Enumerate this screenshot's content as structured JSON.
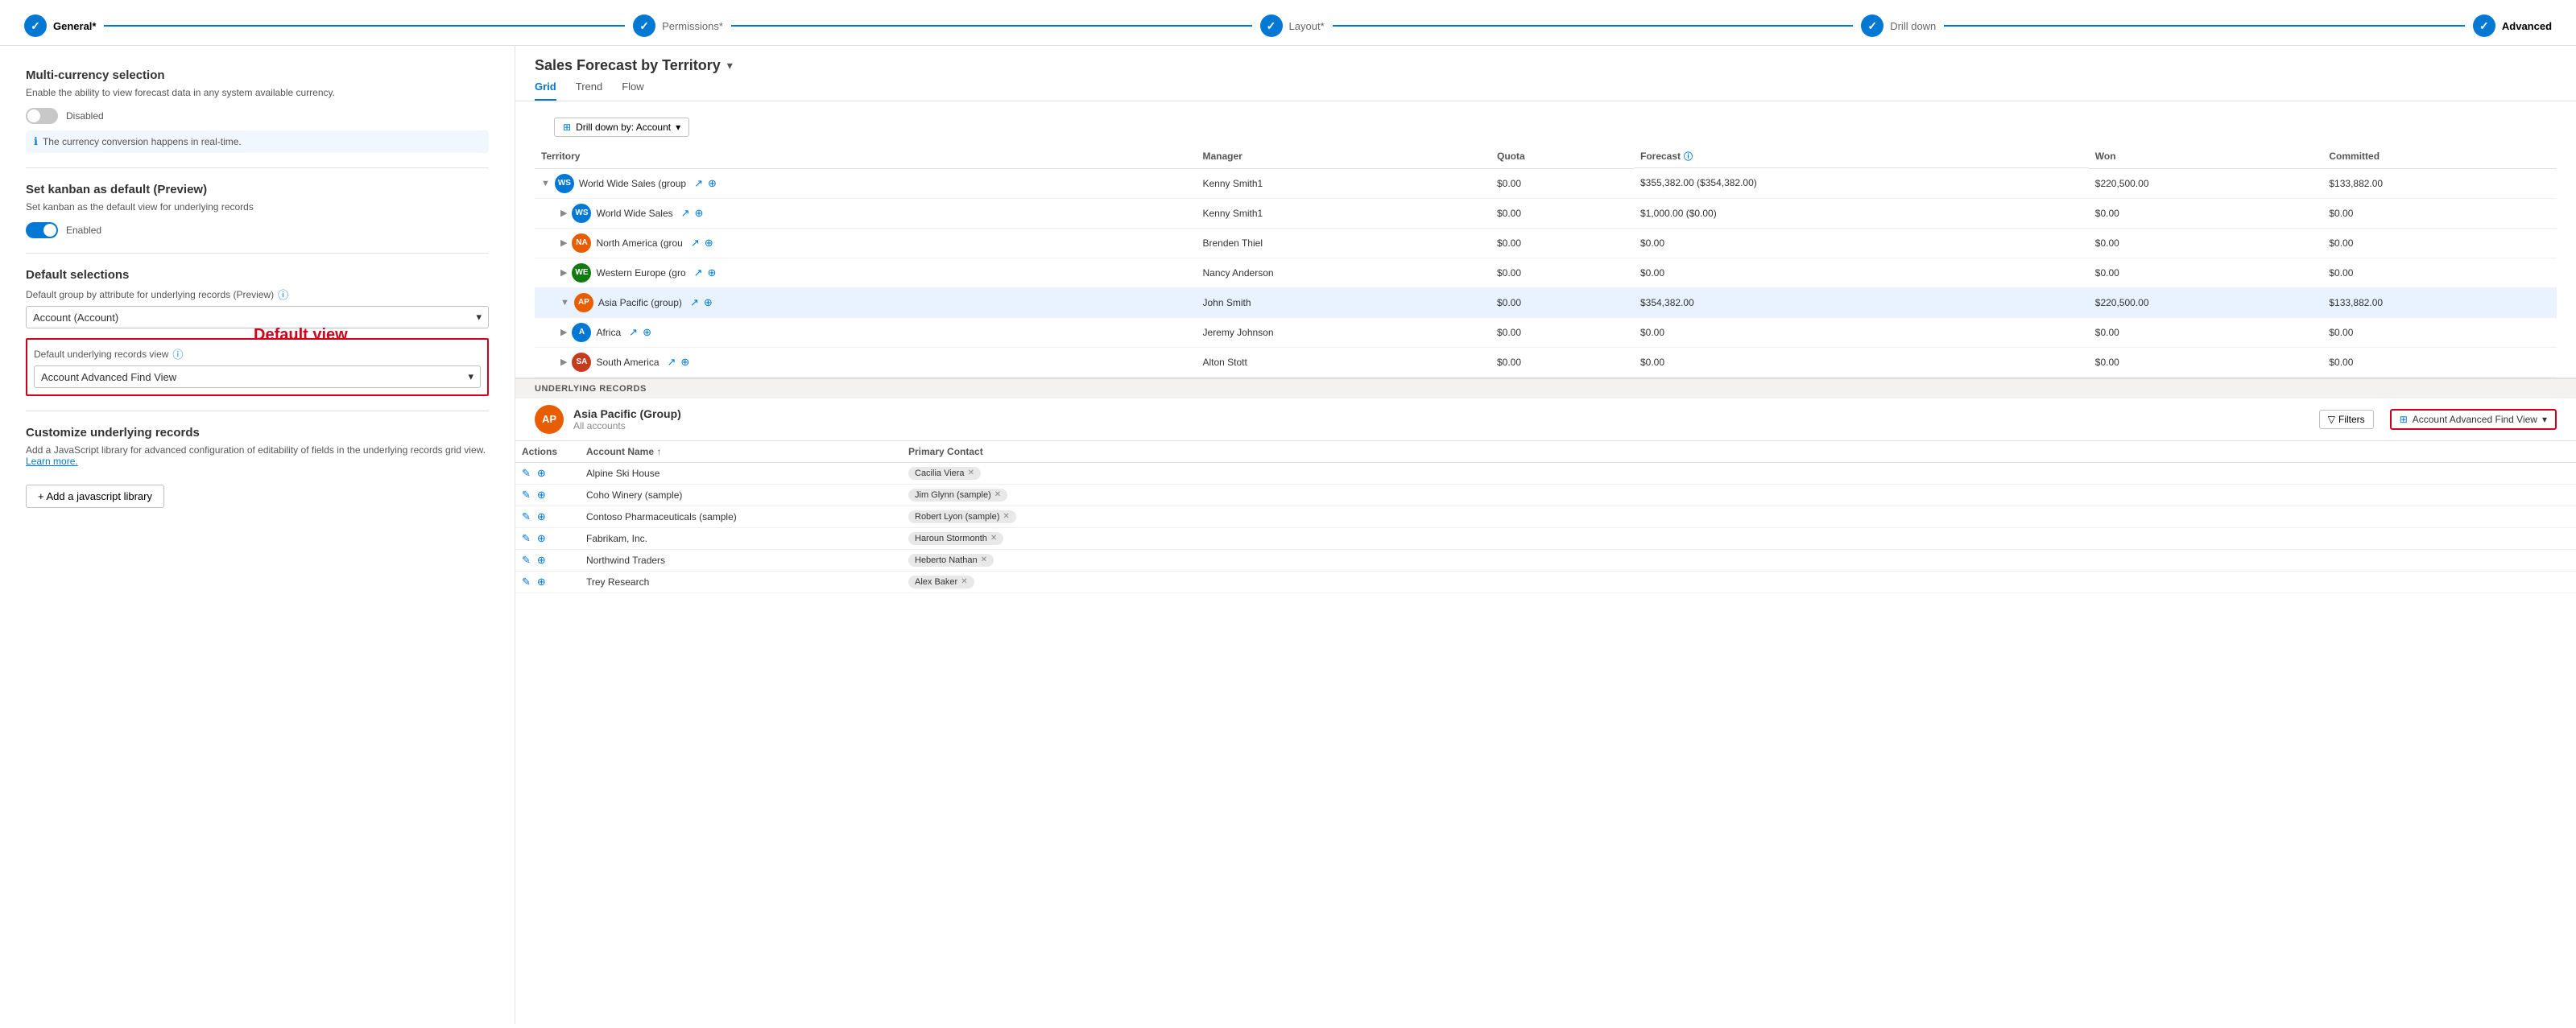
{
  "wizard": {
    "steps": [
      {
        "id": "general",
        "label": "General*",
        "active": false
      },
      {
        "id": "permissions",
        "label": "Permissions*",
        "active": false
      },
      {
        "id": "layout",
        "label": "Layout*",
        "active": false
      },
      {
        "id": "drilldown",
        "label": "Drill down",
        "active": false
      },
      {
        "id": "advanced",
        "label": "Advanced",
        "active": true
      }
    ]
  },
  "left": {
    "multicurrency": {
      "title": "Multi-currency selection",
      "desc": "Enable the ability to view forecast data in any system available currency.",
      "toggle_state": "off",
      "toggle_label": "Disabled",
      "info_text": "The currency conversion happens in real-time."
    },
    "kanban": {
      "title": "Set kanban as default (Preview)",
      "desc": "Set kanban as the default view for underlying records",
      "toggle_state": "on",
      "toggle_label": "Enabled"
    },
    "defaults": {
      "title": "Default selections",
      "group_attr_label": "Default group by attribute for underlying records (Preview)",
      "group_attr_value": "Account (Account)",
      "view_label": "Default underlying records view",
      "view_value": "Account Advanced Find View",
      "annotation": "Default view"
    },
    "customize": {
      "title": "Customize underlying records",
      "desc": "Add a JavaScript library for advanced configuration of editability of fields in the underlying records grid view.",
      "link_text": "Learn more.",
      "btn_label": "+ Add a javascript library"
    }
  },
  "right": {
    "title": "Sales Forecast by Territory",
    "tabs": [
      "Grid",
      "Trend",
      "Flow"
    ],
    "active_tab": "Grid",
    "drill_btn": "Drill down by: Account",
    "table": {
      "columns": [
        "Territory",
        "Manager",
        "Quota",
        "Forecast",
        "Won",
        "Committed"
      ],
      "rows": [
        {
          "indent": 0,
          "expanded": true,
          "avatar_bg": "#0078d4",
          "avatar_text": "WS",
          "territory": "World Wide Sales (group",
          "manager": "Kenny Smith1",
          "quota": "$0.00",
          "forecast": "$355,382.00 ($354,382.00)",
          "won": "$220,500.00",
          "committed": "$133,882.00",
          "highlighted": false
        },
        {
          "indent": 1,
          "expanded": false,
          "avatar_bg": "#0078d4",
          "avatar_text": "WS",
          "territory": "World Wide Sales",
          "manager": "Kenny Smith1",
          "quota": "$0.00",
          "forecast": "$1,000.00 ($0.00)",
          "won": "$0.00",
          "committed": "$0.00",
          "highlighted": false
        },
        {
          "indent": 1,
          "expanded": false,
          "avatar_bg": "#e85d00",
          "avatar_text": "NA",
          "territory": "North America (grou",
          "manager": "Brenden Thiel",
          "quota": "$0.00",
          "forecast": "$0.00",
          "won": "$0.00",
          "committed": "$0.00",
          "highlighted": false
        },
        {
          "indent": 1,
          "expanded": false,
          "avatar_bg": "#107c10",
          "avatar_text": "WE",
          "territory": "Western Europe (gro",
          "manager": "Nancy Anderson",
          "quota": "$0.00",
          "forecast": "$0.00",
          "won": "$0.00",
          "committed": "$0.00",
          "highlighted": false
        },
        {
          "indent": 1,
          "expanded": true,
          "avatar_bg": "#e85d00",
          "avatar_text": "AP",
          "territory": "Asia Pacific (group)",
          "manager": "John Smith",
          "quota": "$0.00",
          "forecast": "$354,382.00",
          "won": "$220,500.00",
          "committed": "$133,882.00",
          "highlighted": true
        },
        {
          "indent": 1,
          "expanded": false,
          "avatar_bg": "#0078d4",
          "avatar_text": "A",
          "territory": "Africa",
          "manager": "Jeremy Johnson",
          "quota": "$0.00",
          "forecast": "$0.00",
          "won": "$0.00",
          "committed": "$0.00",
          "highlighted": false
        },
        {
          "indent": 1,
          "expanded": false,
          "avatar_bg": "#c43b1e",
          "avatar_text": "SA",
          "territory": "South America",
          "manager": "Alton Stott",
          "quota": "$0.00",
          "forecast": "$0.00",
          "won": "$0.00",
          "committed": "$0.00",
          "highlighted": false
        }
      ]
    },
    "underlying": {
      "section_label": "UNDERLYING RECORDS",
      "group_avatar_text": "AP",
      "group_name": "Asia Pacific (Group)",
      "group_sub": "All accounts",
      "filter_btn": "Filters",
      "view_selector": "Account Advanced Find View",
      "table": {
        "columns": [
          "Actions",
          "Account Name ↑",
          "Primary Contact"
        ],
        "rows": [
          {
            "account": "Alpine Ski House",
            "contact": "Cacilia Viera"
          },
          {
            "account": "Coho Winery (sample)",
            "contact": "Jim Glynn (sample)"
          },
          {
            "account": "Contoso Pharmaceuticals (sample)",
            "contact": "Robert Lyon (sample)"
          },
          {
            "account": "Fabrikam, Inc.",
            "contact": "Haroun Stormonth"
          },
          {
            "account": "Northwind Traders",
            "contact": "Heberto Nathan"
          },
          {
            "account": "Trey Research",
            "contact": "Alex Baker"
          }
        ]
      }
    }
  }
}
